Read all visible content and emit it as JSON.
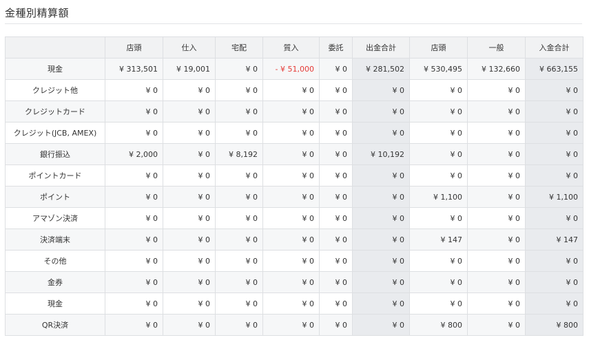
{
  "page": {
    "title": "金種別精算額"
  },
  "table": {
    "columns": [
      "",
      "店頭",
      "仕入",
      "宅配",
      "質入",
      "委託",
      "出金合計",
      "店頭",
      "一般",
      "入金合計"
    ],
    "rows": [
      {
        "label": "現金",
        "cells": [
          "¥ 313,501",
          "¥ 19,001",
          "¥ 0",
          "- ¥ 51,000",
          "¥ 0",
          "¥ 281,502",
          "¥ 530,495",
          "¥ 132,660",
          "¥ 663,155"
        ]
      },
      {
        "label": "クレジット他",
        "cells": [
          "¥ 0",
          "¥ 0",
          "¥ 0",
          "¥ 0",
          "¥ 0",
          "¥ 0",
          "¥ 0",
          "¥ 0",
          "¥ 0"
        ]
      },
      {
        "label": "クレジットカード",
        "cells": [
          "¥ 0",
          "¥ 0",
          "¥ 0",
          "¥ 0",
          "¥ 0",
          "¥ 0",
          "¥ 0",
          "¥ 0",
          "¥ 0"
        ]
      },
      {
        "label": "クレジット(JCB, AMEX)",
        "cells": [
          "¥ 0",
          "¥ 0",
          "¥ 0",
          "¥ 0",
          "¥ 0",
          "¥ 0",
          "¥ 0",
          "¥ 0",
          "¥ 0"
        ]
      },
      {
        "label": "銀行振込",
        "cells": [
          "¥ 2,000",
          "¥ 0",
          "¥ 8,192",
          "¥ 0",
          "¥ 0",
          "¥ 10,192",
          "¥ 0",
          "¥ 0",
          "¥ 0"
        ]
      },
      {
        "label": "ポイントカード",
        "cells": [
          "¥ 0",
          "¥ 0",
          "¥ 0",
          "¥ 0",
          "¥ 0",
          "¥ 0",
          "¥ 0",
          "¥ 0",
          "¥ 0"
        ]
      },
      {
        "label": "ポイント",
        "cells": [
          "¥ 0",
          "¥ 0",
          "¥ 0",
          "¥ 0",
          "¥ 0",
          "¥ 0",
          "¥ 1,100",
          "¥ 0",
          "¥ 1,100"
        ]
      },
      {
        "label": "アマゾン決済",
        "cells": [
          "¥ 0",
          "¥ 0",
          "¥ 0",
          "¥ 0",
          "¥ 0",
          "¥ 0",
          "¥ 0",
          "¥ 0",
          "¥ 0"
        ]
      },
      {
        "label": "決済端末",
        "cells": [
          "¥ 0",
          "¥ 0",
          "¥ 0",
          "¥ 0",
          "¥ 0",
          "¥ 0",
          "¥ 147",
          "¥ 0",
          "¥ 147"
        ]
      },
      {
        "label": "その他",
        "cells": [
          "¥ 0",
          "¥ 0",
          "¥ 0",
          "¥ 0",
          "¥ 0",
          "¥ 0",
          "¥ 0",
          "¥ 0",
          "¥ 0"
        ]
      },
      {
        "label": "金券",
        "cells": [
          "¥ 0",
          "¥ 0",
          "¥ 0",
          "¥ 0",
          "¥ 0",
          "¥ 0",
          "¥ 0",
          "¥ 0",
          "¥ 0"
        ]
      },
      {
        "label": "現金",
        "cells": [
          "¥ 0",
          "¥ 0",
          "¥ 0",
          "¥ 0",
          "¥ 0",
          "¥ 0",
          "¥ 0",
          "¥ 0",
          "¥ 0"
        ]
      },
      {
        "label": "QR決済",
        "cells": [
          "¥ 0",
          "¥ 0",
          "¥ 0",
          "¥ 0",
          "¥ 0",
          "¥ 0",
          "¥ 800",
          "¥ 0",
          "¥ 800"
        ]
      }
    ]
  },
  "colors": {
    "negative": "#e53935",
    "total_column_bg": "#e9ebee",
    "header_bg": "#f1f2f3"
  }
}
